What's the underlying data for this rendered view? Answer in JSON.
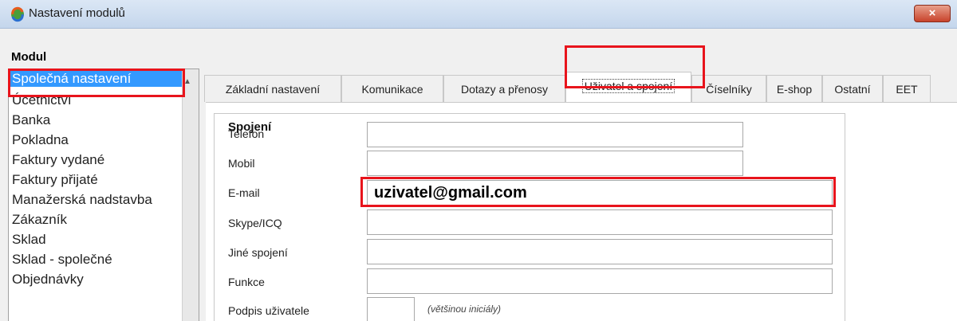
{
  "window": {
    "title": "Nastavení modulů",
    "close_label": "×"
  },
  "module": {
    "header": "Modul",
    "items": [
      "Společná nastavení",
      "Účetnictví",
      "Banka",
      "Pokladna",
      "Faktury vydané",
      "Faktury přijaté",
      "Manažerská nadstavba",
      "Zákazník",
      "Sklad",
      "Sklad - společné",
      "Objednávky"
    ],
    "selected_index": 0
  },
  "tabs": [
    "Základní nastavení",
    "Komunikace",
    "Dotazy a přenosy",
    "Uživatel a spojení",
    "Číselníky",
    "E-shop",
    "Ostatní",
    "EET"
  ],
  "active_tab_index": 3,
  "connection": {
    "section_title": "Spojení",
    "fields": {
      "telefon": {
        "label": "Telefon",
        "value": ""
      },
      "mobil": {
        "label": "Mobil",
        "value": ""
      },
      "email": {
        "label": "E-mail",
        "value": "uzivatel@gmail.com"
      },
      "skype": {
        "label": "Skype/ICQ",
        "value": ""
      },
      "jine": {
        "label": "Jiné spojení",
        "value": ""
      },
      "funkce": {
        "label": "Funkce",
        "value": ""
      },
      "podpis": {
        "label": "Podpis uživatele",
        "value": ""
      }
    },
    "podpis_hint": "(většinou iniciály)"
  },
  "colors": {
    "highlight": "#e8141c",
    "selection": "#3399ff"
  }
}
